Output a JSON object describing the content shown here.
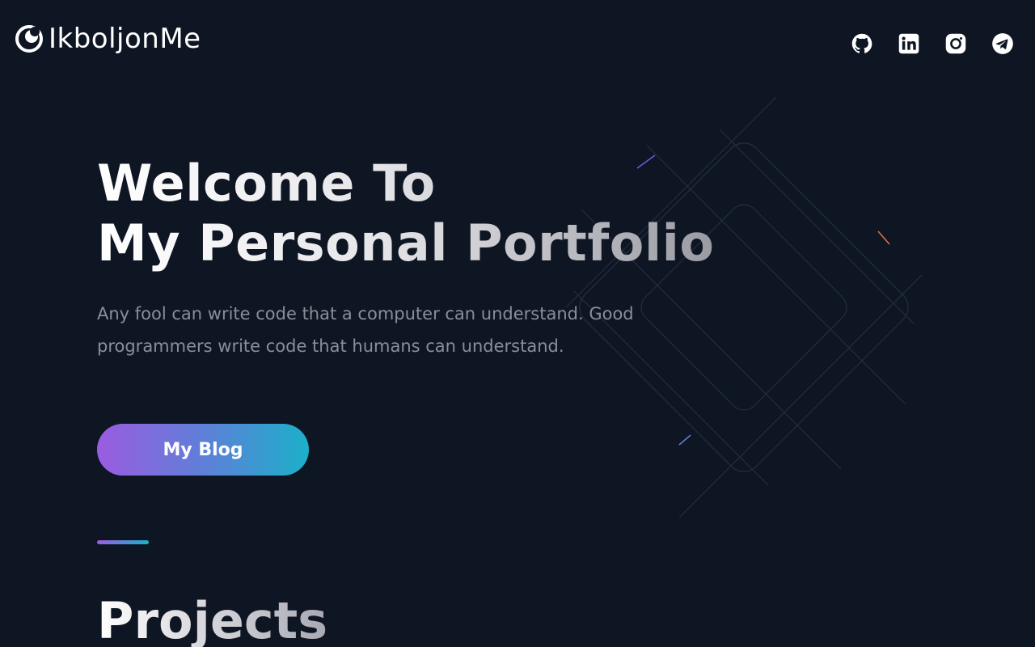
{
  "header": {
    "logo_text": "IkboljonMe",
    "socials": [
      {
        "name": "github",
        "icon": "github-icon"
      },
      {
        "name": "linkedin",
        "icon": "linkedin-icon"
      },
      {
        "name": "instagram",
        "icon": "instagram-icon"
      },
      {
        "name": "telegram",
        "icon": "telegram-icon"
      }
    ]
  },
  "hero": {
    "title_line1": "Welcome To",
    "title_line2": "My Personal Portfolio",
    "quote": "Any fool can write code that a computer can understand. Good programmers write code that humans can understand.",
    "cta_label": "My Blog"
  },
  "projects": {
    "title": "Projects"
  },
  "colors": {
    "background": "#0f1623",
    "gradient_start": "#9b5ce0",
    "gradient_end": "#1bb0c9",
    "muted_text": "#8a8e98"
  }
}
